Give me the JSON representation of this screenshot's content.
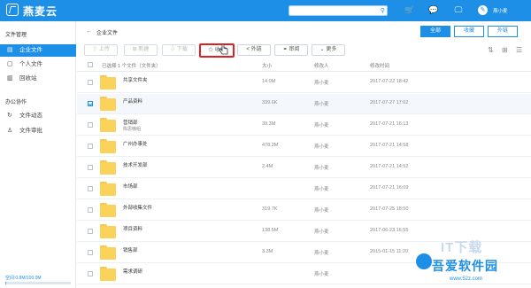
{
  "app": {
    "title": "燕麦云",
    "username": "燕小麦",
    "search_placeholder": ""
  },
  "sidebar": {
    "section1": "文件管理",
    "items1": [
      {
        "label": "企业文件",
        "icon": "folder-icon",
        "active": true
      },
      {
        "label": "个人文件",
        "icon": "user-file-icon",
        "active": false
      },
      {
        "label": "回收站",
        "icon": "trash-icon",
        "active": false
      }
    ],
    "section2": "办公协作",
    "items2": [
      {
        "label": "文件动态",
        "icon": "activity-icon"
      },
      {
        "label": "文件审批",
        "icon": "approval-icon"
      }
    ],
    "quota_label": "空间:0.8M/100.0M",
    "quota_fraction": 0.008
  },
  "main": {
    "breadcrumb": "企业文件",
    "tabs": [
      "全部",
      "收藏",
      "外链"
    ],
    "toolbar": {
      "upload": "上传",
      "new": "新建",
      "download": "下载",
      "favorite": "收藏",
      "share": "外链",
      "audit": "审阅",
      "more": "更多"
    },
    "table": {
      "head_name": "已选择 1 个文件（文件夹）",
      "head_size": "大小",
      "head_author": "修改人",
      "head_time": "修改时间",
      "rows": [
        {
          "name": "共享文件夹",
          "sub": "",
          "size": "14.0M",
          "author": "燕小麦",
          "time": "2017-07-22 18:42",
          "checked": false
        },
        {
          "name": "产品资料",
          "sub": "",
          "size": "339.6K",
          "author": "燕小麦",
          "time": "2017-07-27 17:02",
          "checked": true
        },
        {
          "name": "营销部",
          "sub": "陈思楠组",
          "size": "39.3M",
          "author": "燕小麦",
          "time": "2017-07-21 16:13",
          "checked": false
        },
        {
          "name": "广州办事处",
          "sub": "",
          "size": "478.2M",
          "author": "燕小麦",
          "time": "2017-07-21 14:58",
          "checked": false
        },
        {
          "name": "技术开发部",
          "sub": "",
          "size": "2.4M",
          "author": "燕小麦",
          "time": "2017-07-21 14:52",
          "checked": false
        },
        {
          "name": "市场部",
          "sub": "",
          "size": "",
          "author": "燕小麦",
          "time": "2017-07-21 16:09",
          "checked": false
        },
        {
          "name": "外部收集文件",
          "sub": "",
          "size": "319.7K",
          "author": "燕小麦",
          "time": "2017-07-25 18:50",
          "checked": false
        },
        {
          "name": "项目资料",
          "sub": "",
          "size": "138.5M",
          "author": "燕小麦",
          "time": "2017-06-23 16:55",
          "checked": false
        },
        {
          "name": "销售部",
          "sub": "",
          "size": "3.3M",
          "author": "燕小麦",
          "time": "2015-01-15 11:20",
          "checked": false
        },
        {
          "name": "需求调研",
          "sub": "",
          "size": "",
          "author": "燕小麦",
          "time": "",
          "checked": false
        }
      ]
    }
  },
  "watermark": {
    "brand": "吾爱软件园",
    "site": "www.52z.com",
    "tag": "IT下载"
  }
}
